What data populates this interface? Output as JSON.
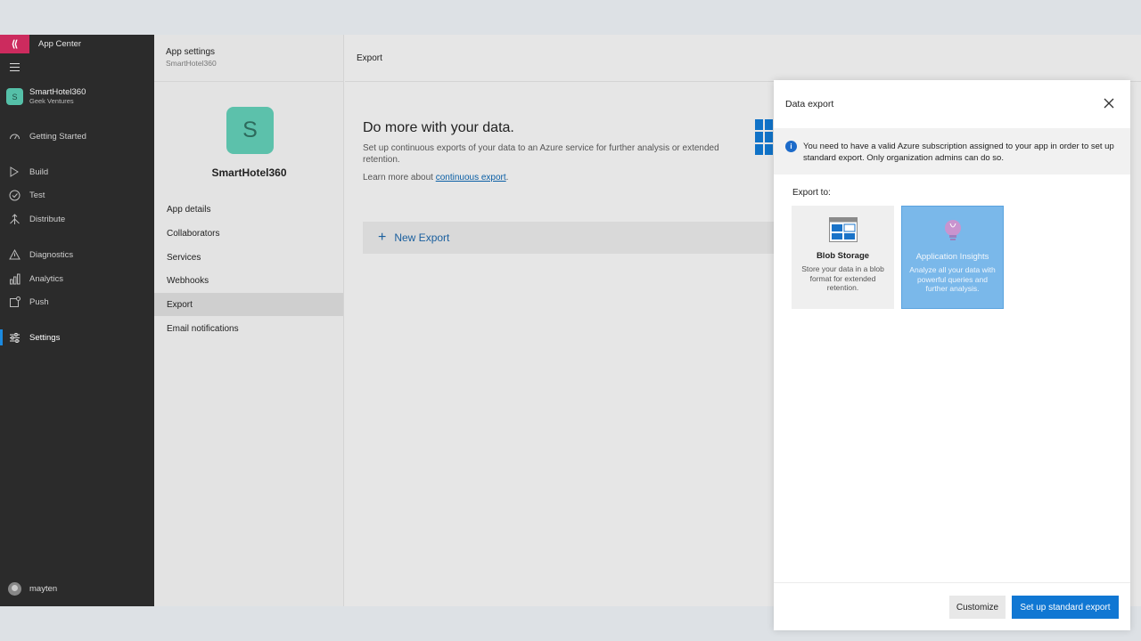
{
  "nav": {
    "brand": "App Center",
    "app": {
      "initial": "S",
      "name": "SmartHotel360",
      "org": "Geek Ventures"
    },
    "items": [
      {
        "label": "Getting Started",
        "icon": "speedometer-icon"
      },
      {
        "label": "Build",
        "icon": "play-icon"
      },
      {
        "label": "Test",
        "icon": "checkmark-circle-icon"
      },
      {
        "label": "Distribute",
        "icon": "distribute-icon"
      },
      {
        "label": "Diagnostics",
        "icon": "warning-icon"
      },
      {
        "label": "Analytics",
        "icon": "bar-chart-icon"
      },
      {
        "label": "Push",
        "icon": "push-icon"
      },
      {
        "label": "Settings",
        "icon": "sliders-icon",
        "active": true
      }
    ],
    "user": "mayten"
  },
  "settings": {
    "title": "App settings",
    "subtitle": "SmartHotel360",
    "app_initial": "S",
    "app_name": "SmartHotel360",
    "items": [
      {
        "label": "App details"
      },
      {
        "label": "Collaborators"
      },
      {
        "label": "Services"
      },
      {
        "label": "Webhooks"
      },
      {
        "label": "Export",
        "active": true
      },
      {
        "label": "Email notifications"
      }
    ]
  },
  "main": {
    "header": "Export",
    "promo_title": "Do more with your data.",
    "promo_desc": "Set up continuous exports of your data to an Azure service for further analysis or extended retention.",
    "learn_prefix": "Learn more about ",
    "learn_link": "continuous export",
    "learn_suffix": ".",
    "new_export": "New Export"
  },
  "panel": {
    "title": "Data export",
    "info": "You need to have a valid Azure subscription assigned to your app in order to set up standard export. Only organization admins can do so.",
    "export_to": "Export to:",
    "cards": [
      {
        "title": "Blob Storage",
        "desc": "Store your data in a blob format for extended retention."
      },
      {
        "title": "Application Insights",
        "desc": "Analyze all your data with powerful queries and further analysis."
      }
    ],
    "customize": "Customize",
    "primary": "Set up standard export"
  },
  "colors": {
    "brand": "#cc2b5e",
    "accent": "#1077d3",
    "selected_card": "#7ab8ea"
  }
}
